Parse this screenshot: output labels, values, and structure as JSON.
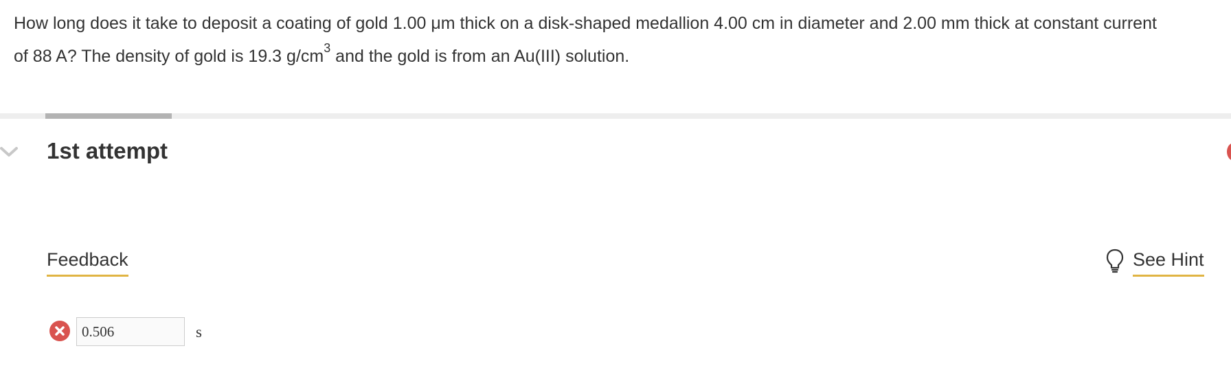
{
  "question": {
    "line1": "How long does it take to deposit a coating of gold 1.00 μm thick on a disk-shaped medallion 4.00 cm in diameter and 2.00 mm thick at constant current",
    "line2_before": "of 88 A? The density of gold is 19.3 g/cm",
    "line2_superscript": "3",
    "line2_after": " and the gold is from an Au(III) solution."
  },
  "attempt": {
    "title": "1st attempt",
    "progress_fraction": 0.1
  },
  "feedback": {
    "label": "Feedback"
  },
  "hint": {
    "label": "See Hint",
    "icon": "lightbulb-icon"
  },
  "answer": {
    "value": "0.506",
    "unit": "s",
    "status": "incorrect",
    "status_icon": "error-x-icon"
  },
  "colors": {
    "text": "#333333",
    "accent_underline": "#e0b442",
    "error": "#d9534f",
    "progress_track": "#eeeeee",
    "progress_fill": "#b3b3b3"
  }
}
